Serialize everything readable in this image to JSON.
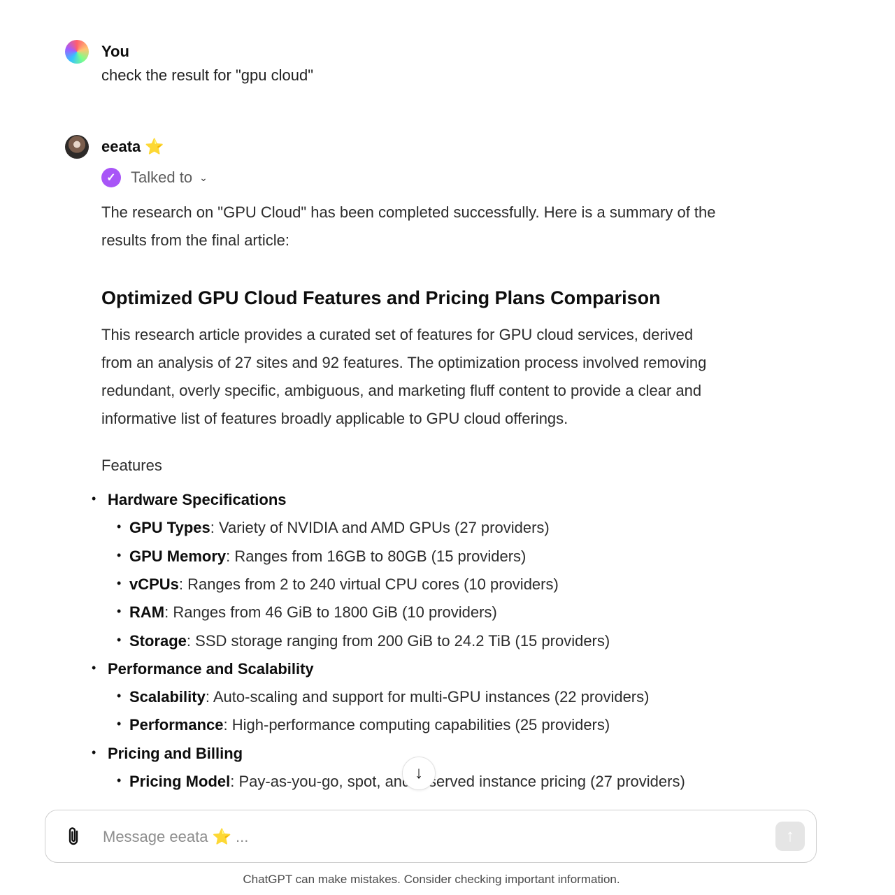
{
  "user_message": {
    "author": "You",
    "text": "check the result for \"gpu cloud\""
  },
  "assistant_message": {
    "author": "eeata",
    "author_emoji": "⭐",
    "talked_to": "Talked to",
    "intro": "The research on \"GPU Cloud\" has been completed successfully. Here is a summary of the results from the final article:",
    "heading": "Optimized GPU Cloud Features and Pricing Plans Comparison",
    "paragraph": "This research article provides a curated set of features for GPU cloud services, derived from an analysis of 27 sites and 92 features. The optimization process involved removing redundant, overly specific, ambiguous, and marketing fluff content to provide a clear and informative list of features broadly applicable to GPU cloud offerings.",
    "features_label": "Features",
    "sections": [
      {
        "title": "Hardware Specifications",
        "items": [
          {
            "name": "GPU Types",
            "text": ": Variety of NVIDIA and AMD GPUs (27 providers)"
          },
          {
            "name": "GPU Memory",
            "text": ": Ranges from 16GB to 80GB (15 providers)"
          },
          {
            "name": "vCPUs",
            "text": ": Ranges from 2 to 240 virtual CPU cores (10 providers)"
          },
          {
            "name": "RAM",
            "text": ": Ranges from 46 GiB to 1800 GiB (10 providers)"
          },
          {
            "name": "Storage",
            "text": ": SSD storage ranging from 200 GiB to 24.2 TiB (15 providers)"
          }
        ]
      },
      {
        "title": "Performance and Scalability",
        "items": [
          {
            "name": "Scalability",
            "text": ": Auto-scaling and support for multi-GPU instances (22 providers)"
          },
          {
            "name": "Performance",
            "text": ": High-performance computing capabilities (25 providers)"
          }
        ]
      },
      {
        "title": "Pricing and Billing",
        "items": [
          {
            "name": "Pricing Model",
            "text": ": Pay-as-you-go, spot, and reserved instance pricing (27 providers)"
          }
        ]
      }
    ]
  },
  "composer": {
    "placeholder": "Message eeata ⭐ ..."
  },
  "footer": {
    "disclaimer": "ChatGPT can make mistakes. Consider checking important information."
  },
  "icons": {
    "attach": "paperclip-icon",
    "send": "arrow-up-icon",
    "scroll": "arrow-down-icon",
    "check": "check-icon"
  }
}
